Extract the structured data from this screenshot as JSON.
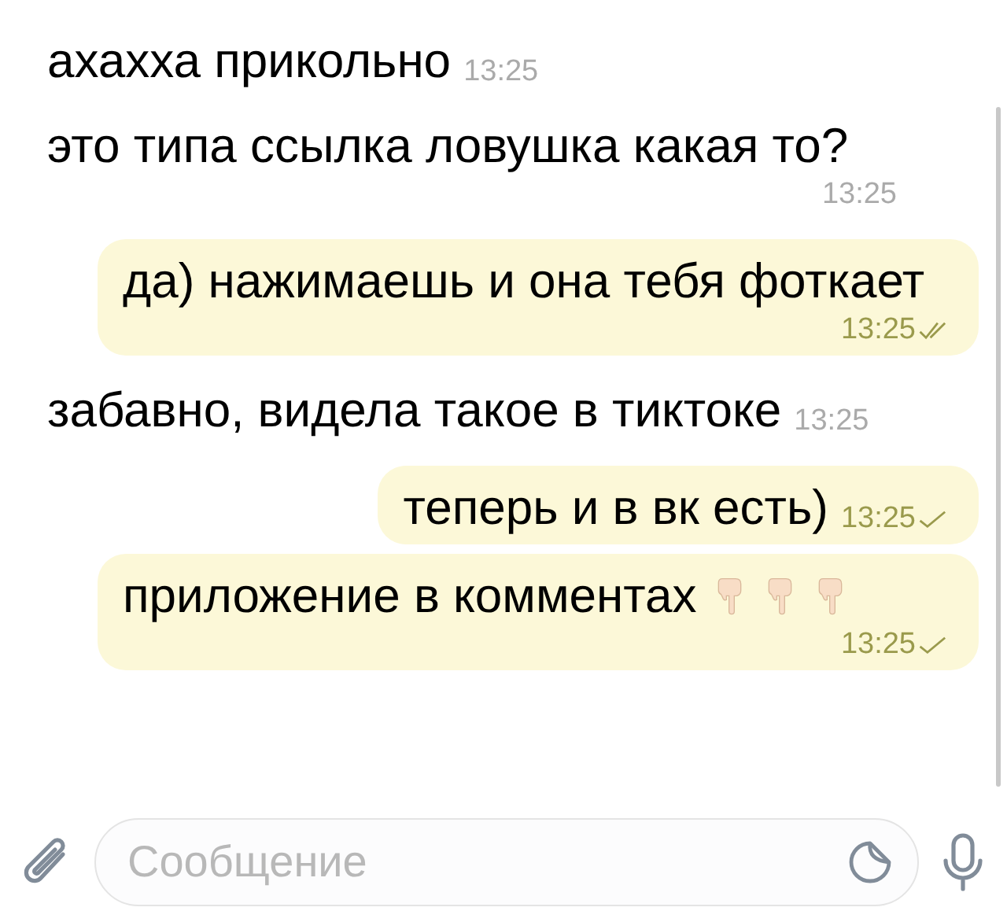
{
  "messages": [
    {
      "kind": "incoming",
      "text": "ахахха прикольно",
      "time": "13:25"
    },
    {
      "kind": "incoming",
      "text": "это типа ссылка ловушка какая то?",
      "time": "13:25"
    },
    {
      "kind": "outgoing",
      "text": "да) нажимаешь и она тебя фоткает",
      "time": "13:25",
      "read": true
    },
    {
      "kind": "incoming",
      "text": "забавно, видела такое в тиктоке",
      "time": "13:25"
    },
    {
      "kind": "outgoing",
      "text": "теперь и в вк есть)",
      "time": "13:25",
      "read": false
    },
    {
      "kind": "outgoing",
      "text": "приложение в комментах",
      "time": "13:25",
      "read": false,
      "trailing_icons": [
        {
          "kind": "point-down"
        },
        {
          "kind": "point-down"
        },
        {
          "kind": "point-down"
        }
      ]
    }
  ],
  "composer": {
    "placeholder": "Сообщение"
  }
}
